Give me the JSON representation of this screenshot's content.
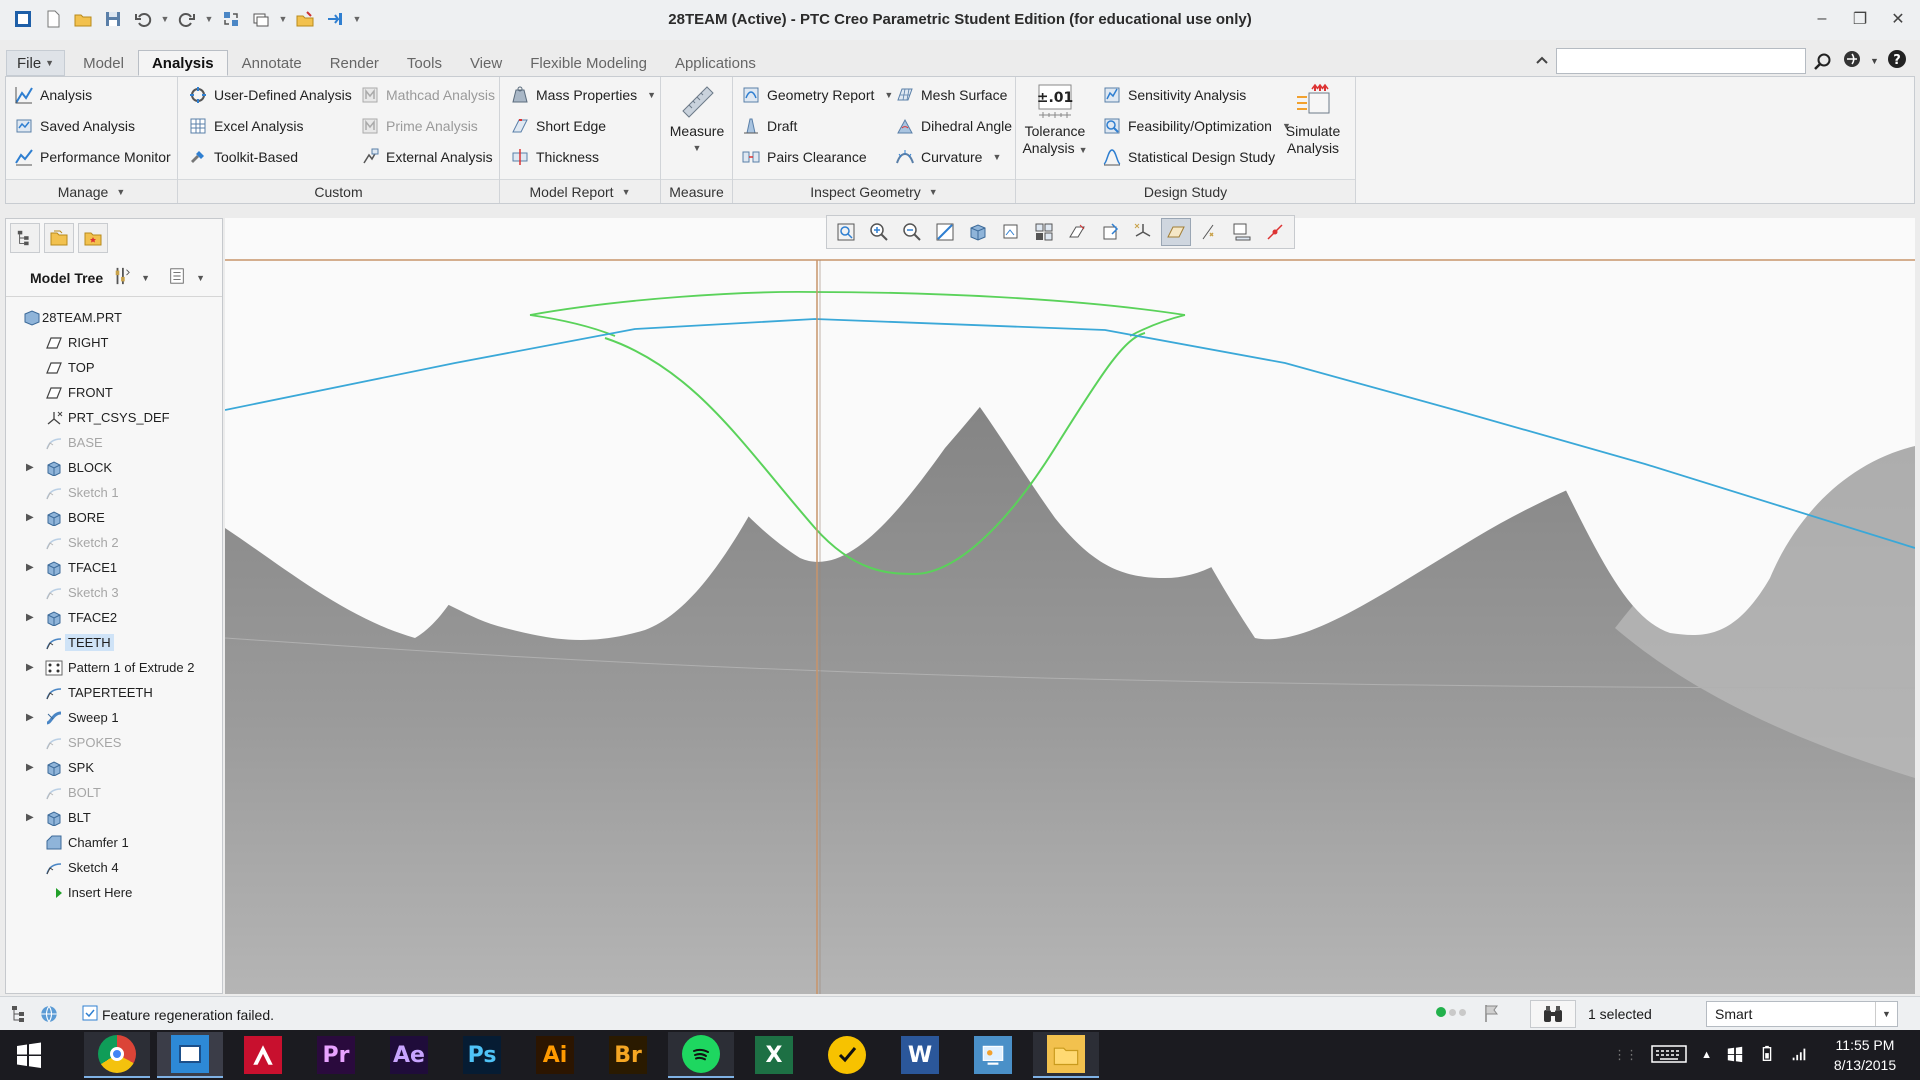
{
  "window": {
    "title": "28TEAM (Active) - PTC Creo Parametric Student Edition (for educational use only)"
  },
  "tabs": [
    {
      "label": "File",
      "name": "tab-file"
    },
    {
      "label": "Model",
      "name": "tab-model"
    },
    {
      "label": "Analysis",
      "name": "tab-analysis"
    },
    {
      "label": "Annotate",
      "name": "tab-annotate"
    },
    {
      "label": "Render",
      "name": "tab-render"
    },
    {
      "label": "Tools",
      "name": "tab-tools"
    },
    {
      "label": "View",
      "name": "tab-view"
    },
    {
      "label": "Flexible Modeling",
      "name": "tab-flexible-modeling"
    },
    {
      "label": "Applications",
      "name": "tab-applications"
    }
  ],
  "search": {
    "value": ""
  },
  "ribbon": {
    "manage": {
      "label": "Manage",
      "analysis": "Analysis",
      "saved_analysis": "Saved Analysis",
      "performance_monitor": "Performance Monitor"
    },
    "custom": {
      "label": "Custom",
      "user_defined_analysis": "User-Defined Analysis",
      "excel_analysis": "Excel Analysis",
      "toolkit_based": "Toolkit-Based",
      "mathcad_analysis": "Mathcad Analysis",
      "prime_analysis": "Prime Analysis",
      "external_analysis": "External Analysis"
    },
    "model_report": {
      "label": "Model Report",
      "mass_properties": "Mass Properties",
      "short_edge": "Short Edge",
      "thickness": "Thickness"
    },
    "measure": {
      "label": "Measure",
      "measure": "Measure"
    },
    "inspect_geometry": {
      "label": "Inspect Geometry",
      "geometry_report": "Geometry Report",
      "draft": "Draft",
      "pairs_clearance": "Pairs Clearance",
      "mesh_surface": "Mesh Surface",
      "dihedral_angle": "Dihedral Angle",
      "curvature": "Curvature"
    },
    "design_study": {
      "label": "Design Study",
      "tolerance_line1": "Tolerance",
      "tolerance_line2": "Analysis",
      "tolerance_icon_text": "±.01",
      "sensitivity_analysis": "Sensitivity Analysis",
      "feasibility_optimization": "Feasibility/Optimization",
      "statistical_design_study": "Statistical Design Study",
      "simulate_line1": "Simulate",
      "simulate_line2": "Analysis"
    }
  },
  "model_tree": {
    "header": "Model Tree",
    "items": [
      {
        "label": "28TEAM.PRT",
        "icon": "part-icon",
        "state": "root",
        "expand": false
      },
      {
        "label": "RIGHT",
        "icon": "datum-plane-icon",
        "state": "normal",
        "expand": false
      },
      {
        "label": "TOP",
        "icon": "datum-plane-icon",
        "state": "normal",
        "expand": false
      },
      {
        "label": "FRONT",
        "icon": "datum-plane-icon",
        "state": "normal",
        "expand": false
      },
      {
        "label": "PRT_CSYS_DEF",
        "icon": "csys-icon",
        "state": "normal",
        "expand": false
      },
      {
        "label": "BASE",
        "icon": "sketch-icon",
        "state": "suppressed",
        "expand": false
      },
      {
        "label": "BLOCK",
        "icon": "extrude-icon",
        "state": "normal",
        "expand": true
      },
      {
        "label": "Sketch 1",
        "icon": "sketch-icon",
        "state": "suppressed",
        "expand": false
      },
      {
        "label": "BORE",
        "icon": "extrude-icon",
        "state": "normal",
        "expand": true
      },
      {
        "label": "Sketch 2",
        "icon": "sketch-icon",
        "state": "suppressed",
        "expand": false
      },
      {
        "label": "TFACE1",
        "icon": "extrude-icon",
        "state": "normal",
        "expand": true
      },
      {
        "label": "Sketch 3",
        "icon": "sketch-icon",
        "state": "suppressed",
        "expand": false
      },
      {
        "label": "TFACE2",
        "icon": "extrude-icon",
        "state": "normal",
        "expand": true
      },
      {
        "label": "TEETH",
        "icon": "sketch-icon",
        "state": "selected",
        "expand": false
      },
      {
        "label": "Pattern 1 of Extrude 2",
        "icon": "pattern-icon",
        "state": "normal",
        "expand": true
      },
      {
        "label": "TAPERTEETH",
        "icon": "sketch-icon",
        "state": "normal",
        "expand": false
      },
      {
        "label": "Sweep 1",
        "icon": "sweep-icon",
        "state": "normal",
        "expand": true
      },
      {
        "label": "SPOKES",
        "icon": "sketch-icon",
        "state": "suppressed",
        "expand": false
      },
      {
        "label": "SPK",
        "icon": "extrude-icon",
        "state": "normal",
        "expand": true
      },
      {
        "label": "BOLT",
        "icon": "sketch-icon",
        "state": "suppressed",
        "expand": false
      },
      {
        "label": "BLT",
        "icon": "extrude-icon",
        "state": "normal",
        "expand": true
      },
      {
        "label": "Chamfer 1",
        "icon": "chamfer-icon",
        "state": "normal",
        "expand": false
      },
      {
        "label": "Sketch 4",
        "icon": "sketch-icon",
        "state": "normal",
        "expand": false
      },
      {
        "label": "Insert Here",
        "icon": "insert-here-icon",
        "state": "normal",
        "expand": false
      }
    ]
  },
  "status": {
    "message": "Feature regeneration failed.",
    "selected": "1 selected",
    "filter": "Smart"
  },
  "taskbar": {
    "apps": [
      {
        "name": "chrome",
        "text": "",
        "bg": "#ffffff",
        "fg": "#ffffff"
      },
      {
        "name": "creo",
        "text": "",
        "bg": "#2d89d6",
        "fg": "#ffffff"
      },
      {
        "name": "autocad",
        "text": "",
        "bg": "#c8102e",
        "fg": "#ffffff"
      },
      {
        "name": "premiere",
        "text": "Pr",
        "bg": "#2a0a3d",
        "fg": "#e8a3ff"
      },
      {
        "name": "after-effects",
        "text": "Ae",
        "bg": "#1f0c3a",
        "fg": "#c8a4ff"
      },
      {
        "name": "photoshop",
        "text": "Ps",
        "bg": "#061c33",
        "fg": "#4fc3f7"
      },
      {
        "name": "illustrator",
        "text": "Ai",
        "bg": "#2c1500",
        "fg": "#ff9a00"
      },
      {
        "name": "bridge",
        "text": "Br",
        "bg": "#2a1a00",
        "fg": "#f5a623"
      },
      {
        "name": "spotify",
        "text": "",
        "bg": "#1ed760",
        "fg": "#111111"
      },
      {
        "name": "excel",
        "text": "X",
        "bg": "#1d7044",
        "fg": "#ffffff"
      },
      {
        "name": "norton",
        "text": "",
        "bg": "#f7c200",
        "fg": "#111111"
      },
      {
        "name": "word",
        "text": "W",
        "bg": "#2b579a",
        "fg": "#ffffff"
      },
      {
        "name": "control-panel",
        "text": "",
        "bg": "#4a90c8",
        "fg": "#ffffff"
      },
      {
        "name": "file-explorer",
        "text": "",
        "bg": "#f2c14e",
        "fg": "#ffffff"
      }
    ],
    "time": "11:55 PM",
    "date": "8/13/2015"
  },
  "colors": {
    "accent": "#2f7fd1",
    "ok_green": "#22b14c",
    "sketch_green": "#5ad25a",
    "curve_blue": "#3aa8d8",
    "datum_orange": "#c8946a"
  }
}
